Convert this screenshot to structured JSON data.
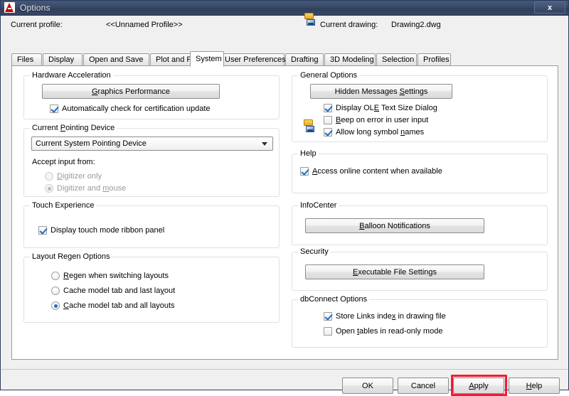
{
  "window": {
    "title": "Options",
    "app_icon": "autocad-a-logo-icon",
    "close_label": "x"
  },
  "header": {
    "profile_label": "Current profile:",
    "profile_value": "<<Unnamed Profile>>",
    "drawing_icon": "drawing-file-icon",
    "drawing_label": "Current drawing:",
    "drawing_value": "Drawing2.dwg"
  },
  "tabs": [
    {
      "label": "Files",
      "active": false
    },
    {
      "label": "Display",
      "active": false
    },
    {
      "label": "Open and Save",
      "active": false
    },
    {
      "label": "Plot and Publish",
      "active": false
    },
    {
      "label": "System",
      "active": true
    },
    {
      "label": "User Preferences",
      "active": false
    },
    {
      "label": "Drafting",
      "active": false
    },
    {
      "label": "3D Modeling",
      "active": false
    },
    {
      "label": "Selection",
      "active": false
    },
    {
      "label": "Profiles",
      "active": false
    }
  ],
  "left_column": {
    "hardware_acceleration": {
      "legend": "Hardware Acceleration",
      "button": {
        "label": "Graphics Performance",
        "mnemonic": "G"
      },
      "checkbox": {
        "label": "Automatically check for certification update",
        "checked": true
      }
    },
    "pointing_device": {
      "legend": "Current Pointing Device",
      "legend_mnemonic": "P",
      "combo_value": "Current System Pointing Device",
      "accept_input_label": "Accept input from:",
      "radios": [
        {
          "label": "Digitizer only",
          "mnemonic": "D",
          "checked": false,
          "disabled": true
        },
        {
          "label": "Digitizer and mouse",
          "mnemonic": "m",
          "checked": true,
          "disabled": true
        }
      ]
    },
    "touch_experience": {
      "legend": "Touch Experience",
      "checkbox": {
        "label": "Display touch mode ribbon panel",
        "mnemonic": "y",
        "checked": true
      }
    },
    "layout_regen": {
      "legend": "Layout Regen Options",
      "radios": [
        {
          "label": "Regen when switching layouts",
          "mnemonic": "R",
          "checked": false
        },
        {
          "label": "Cache model tab and last layout",
          "mnemonic": "y",
          "checked": false
        },
        {
          "label": "Cache model tab and all layouts",
          "mnemonic": "C",
          "checked": true
        }
      ]
    }
  },
  "right_column": {
    "general_options": {
      "legend": "General Options",
      "button": {
        "label": "Hidden Messages Settings",
        "mnemonic": "S"
      },
      "checkboxes": [
        {
          "label": "Display OLE Text Size Dialog",
          "mnemonic": "E",
          "checked": true,
          "icon": ""
        },
        {
          "label": "Beep on error in user input",
          "mnemonic": "B",
          "checked": false,
          "icon": ""
        },
        {
          "label": "Allow long symbol names",
          "mnemonic": "n",
          "checked": true,
          "icon": "drawing-file-icon"
        }
      ]
    },
    "help": {
      "legend": "Help",
      "checkbox": {
        "label": "Access online content when available",
        "mnemonic": "A",
        "checked": true
      }
    },
    "infocenter": {
      "legend": "InfoCenter",
      "button": {
        "label": "Balloon Notifications",
        "mnemonic": "B"
      }
    },
    "security": {
      "legend": "Security",
      "button": {
        "label": "Executable File Settings",
        "mnemonic": "E"
      }
    },
    "dbconnect": {
      "legend": "dbConnect Options",
      "checkboxes": [
        {
          "label": "Store Links index in drawing file",
          "mnemonic": "x",
          "checked": true
        },
        {
          "label": "Open tables in read-only mode",
          "mnemonic": "t",
          "checked": false
        }
      ]
    }
  },
  "footer": {
    "ok": "OK",
    "cancel": "Cancel",
    "apply": "Apply",
    "help": "Help",
    "highlight_color": "#ef1c34",
    "highlight_target": "apply"
  }
}
